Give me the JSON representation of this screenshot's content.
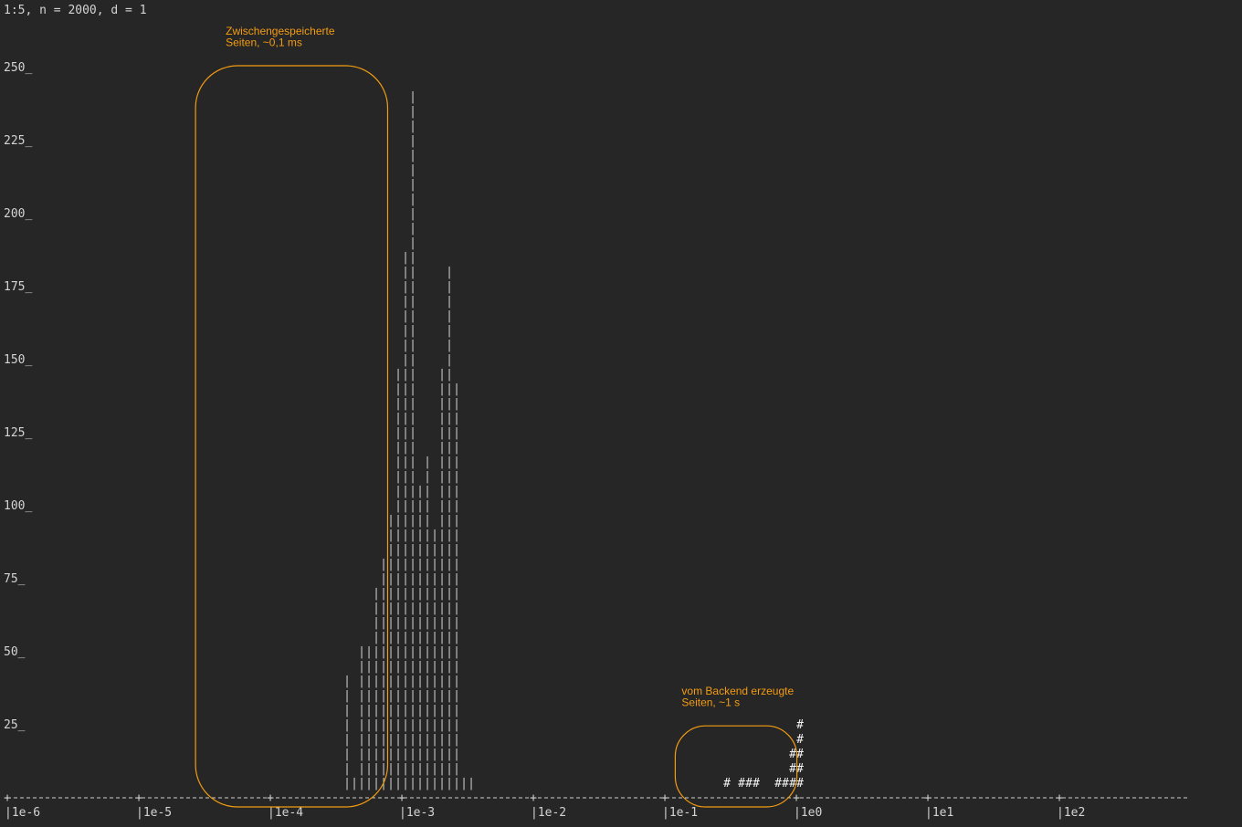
{
  "header": "1:5, n = 2000, d = 1",
  "colors": {
    "background": "#262626",
    "text": "#d4d4d4",
    "annotation": "#f39c12"
  },
  "chart_data": {
    "type": "bar",
    "style": "ascii-histogram",
    "x_scale": "log",
    "xlim": [
      1e-06,
      1000
    ],
    "ylim": [
      0,
      262.5
    ],
    "y_ticks": [
      25,
      50,
      75,
      100,
      125,
      150,
      175,
      200,
      225,
      250
    ],
    "y_tick_labels": [
      "25_",
      "50_",
      "75_",
      "100_",
      "125_",
      "150_",
      "175_",
      "200_",
      "225_",
      "250_"
    ],
    "x_ticks": [
      1e-06,
      1e-05,
      0.0001,
      0.001,
      0.01,
      0.1,
      1,
      10,
      100
    ],
    "x_tick_labels": [
      "|1e-6",
      "|1e-5",
      "|1e-4",
      "|1e-3",
      "|1e-2",
      "|1e-1",
      "|1e0",
      "|1e1",
      "|1e2"
    ],
    "bins_per_decade": 18,
    "first_bin_left": 1e-06,
    "series": [
      {
        "glyph": "|",
        "start_bin": 46,
        "counts": [
          42,
          5,
          52,
          52,
          68,
          82,
          97,
          143,
          187,
          242,
          105,
          117,
          90,
          147,
          182,
          140,
          5,
          5
        ]
      },
      {
        "glyph": "#",
        "start_bin": 98,
        "counts": [
          5,
          0,
          5,
          5,
          5,
          0,
          0,
          5,
          5,
          15,
          25
        ]
      }
    ],
    "annotations": [
      {
        "lines": [
          "Zwischengespeicherte",
          "Seiten, ~0,1 ms"
        ],
        "x_range": [
          2.7e-05,
          0.00078
        ],
        "y_range": [
          -5,
          245
        ]
      },
      {
        "lines": [
          "vom Backend erzeugte",
          "Seiten, ~1 s"
        ],
        "x_range": [
          0.12,
          1.01
        ],
        "y_range": [
          -5,
          19
        ]
      }
    ]
  }
}
